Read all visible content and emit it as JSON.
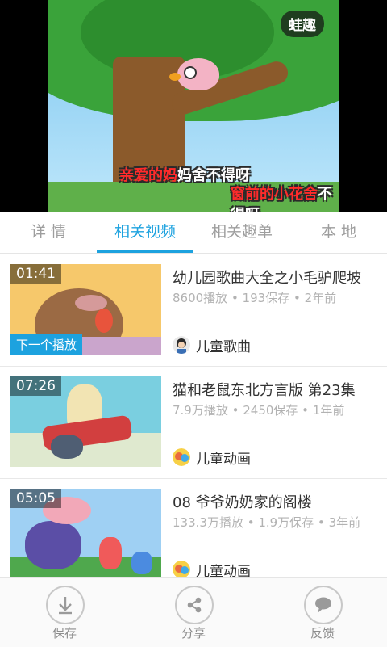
{
  "player": {
    "logo": "蛙趣",
    "subtitle_line1_highlight": "亲爱的妈",
    "subtitle_line1_rest": "妈舍不得呀",
    "subtitle_line2_highlight": "窗前的小花舍",
    "subtitle_line2_rest": "不得呀"
  },
  "tabs": [
    {
      "label": "详 情",
      "active": false
    },
    {
      "label": "相关视频",
      "active": true
    },
    {
      "label": "相关趣单",
      "active": false
    },
    {
      "label": "本 地",
      "active": false
    }
  ],
  "videos": [
    {
      "duration": "01:41",
      "badge": "下一个播放",
      "title": "幼儿园歌曲大全之小毛驴爬坡",
      "meta": "8600播放 • 193保存 • 2年前",
      "channel": "儿童歌曲"
    },
    {
      "duration": "07:26",
      "title": "猫和老鼠东北方言版 第23集",
      "meta": "7.9万播放 • 2450保存 • 1年前",
      "channel": "儿童动画"
    },
    {
      "duration": "05:05",
      "title": "08 爷爷奶奶家的阁楼",
      "meta": "133.3万播放 • 1.9万保存 • 3年前",
      "channel": "儿童动画"
    }
  ],
  "bottom_bar": [
    {
      "label": "保存",
      "icon": "download-icon"
    },
    {
      "label": "分享",
      "icon": "share-icon"
    },
    {
      "label": "反馈",
      "icon": "feedback-icon"
    }
  ],
  "colors": {
    "accent": "#1da2df",
    "text": "#333333",
    "muted": "#b2b2b2"
  }
}
